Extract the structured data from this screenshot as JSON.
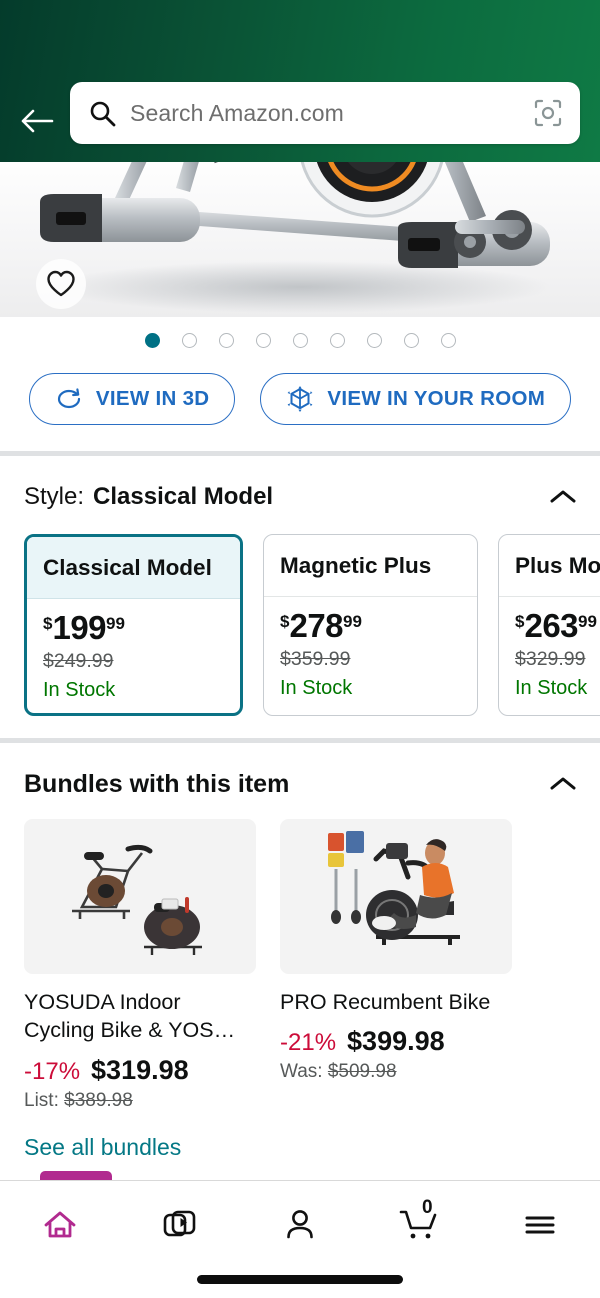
{
  "header": {
    "back_icon": "back-arrow-icon",
    "search": {
      "placeholder": "Search Amazon.com",
      "search_icon": "search-icon",
      "camera_icon": "camera-scan-icon"
    }
  },
  "gallery": {
    "wishlist_icon": "heart-outline-icon",
    "dots_total": 9,
    "active_dot_index": 0,
    "active_dot_color": "#007185",
    "buttons": [
      {
        "label": "VIEW IN 3D",
        "icon": "rotate-3d-icon"
      },
      {
        "label": "VIEW IN YOUR ROOM",
        "icon": "ar-cube-icon"
      }
    ]
  },
  "style_section": {
    "label": "Style:",
    "selected_value": "Classical Model",
    "collapse_icon": "chevron-up-icon",
    "options": [
      {
        "name": "Classical Model",
        "currency": "$",
        "whole": "199",
        "fraction": "99",
        "was_price": "$249.99",
        "availability": "In Stock",
        "selected": true
      },
      {
        "name": "Magnetic Plus",
        "currency": "$",
        "whole": "278",
        "fraction": "99",
        "was_price": "$359.99",
        "availability": "In Stock",
        "selected": false
      },
      {
        "name": "Plus Mo",
        "currency": "$",
        "whole": "263",
        "fraction": "99",
        "was_price": "$329.99",
        "availability": "In Stock",
        "selected": false
      }
    ]
  },
  "bundles_section": {
    "title": "Bundles with this item",
    "collapse_icon": "chevron-up-icon",
    "items": [
      {
        "title": "YOSUDA Indoor Cycling Bike & YOS…",
        "discount": "-17%",
        "price": "$319.98",
        "list_prefix": "List:",
        "list_price": "$389.98"
      },
      {
        "title": "PRO Recumbent Bike",
        "discount": "-21%",
        "price": "$399.98",
        "list_prefix": "Was:",
        "list_price": "$509.98"
      }
    ],
    "see_all_label": "See all bundles"
  },
  "bottom_nav": {
    "active_color": "#b12a8f",
    "items": [
      {
        "icon": "home-icon",
        "active": true
      },
      {
        "icon": "media-video-icon",
        "active": false
      },
      {
        "icon": "account-person-icon",
        "active": false
      },
      {
        "icon": "shopping-cart-icon",
        "active": false,
        "badge": "0"
      },
      {
        "icon": "hamburger-menu-icon",
        "active": false
      }
    ]
  }
}
